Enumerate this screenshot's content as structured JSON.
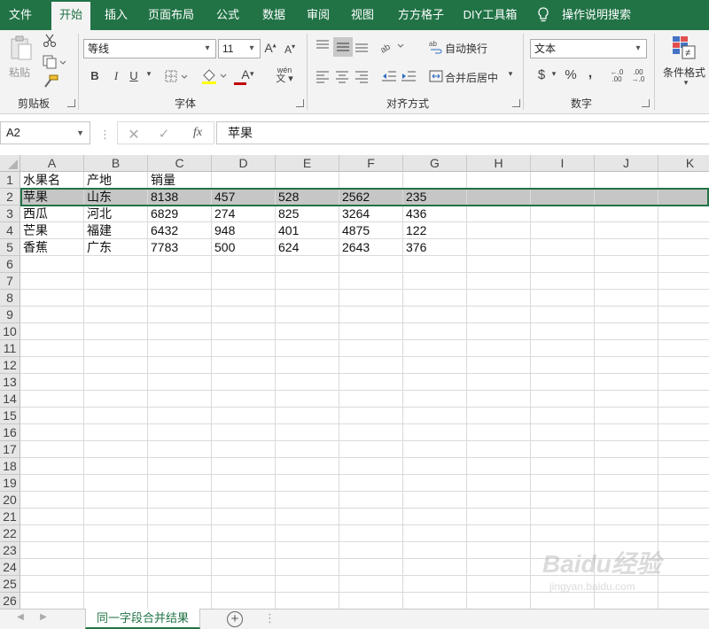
{
  "menu": [
    {
      "label": "文件",
      "active": false
    },
    {
      "label": "开始",
      "active": true
    },
    {
      "label": "插入",
      "active": false
    },
    {
      "label": "页面布局",
      "active": false
    },
    {
      "label": "公式",
      "active": false
    },
    {
      "label": "数据",
      "active": false
    },
    {
      "label": "审阅",
      "active": false
    },
    {
      "label": "视图",
      "active": false
    },
    {
      "label": "方方格子",
      "active": false
    },
    {
      "label": "DIY工具箱",
      "active": false
    },
    {
      "label": "操作说明搜索",
      "active": false
    }
  ],
  "ribbon": {
    "clipboard": {
      "paste_label": "粘贴",
      "group_label": "剪贴板"
    },
    "font": {
      "font_name": "等线",
      "font_size": "11",
      "bold": "B",
      "italic": "I",
      "underline": "U",
      "phonetic": "wén",
      "group_label": "字体",
      "grow": "A",
      "shrink": "A",
      "font_color": "A"
    },
    "alignment": {
      "wrap_text": "自动换行",
      "merge_center": "合并后居中",
      "group_label": "对齐方式"
    },
    "number": {
      "format": "文本",
      "currency": "$",
      "percent": "%",
      "comma": ",",
      "inc_decimal": "←.0 .00",
      "dec_decimal": ".00 →.0",
      "group_label": "数字"
    },
    "styles": {
      "conditional_format": "条件格式"
    }
  },
  "formula_bar": {
    "name_box": "A2",
    "fx": "fx",
    "content": "苹果"
  },
  "grid": {
    "columns": [
      "A",
      "B",
      "C",
      "D",
      "E",
      "F",
      "G",
      "H",
      "I",
      "J",
      "K"
    ],
    "row_numbers": [
      "1",
      "2",
      "3",
      "4",
      "5",
      "6",
      "7",
      "8",
      "9",
      "10",
      "11",
      "12",
      "13",
      "14",
      "15",
      "16",
      "17",
      "18",
      "19",
      "20",
      "21",
      "22",
      "23",
      "24",
      "25",
      "26"
    ],
    "selected_row": 2,
    "active_cell": "A2",
    "rows": [
      [
        "水果名",
        "产地",
        "销量",
        "",
        "",
        "",
        ""
      ],
      [
        "苹果",
        "山东",
        "8138",
        "457",
        "528",
        "2562",
        "235"
      ],
      [
        "西瓜",
        "河北",
        "6829",
        "274",
        "825",
        "3264",
        "436"
      ],
      [
        "芒果",
        "福建",
        "6432",
        "948",
        "401",
        "4875",
        "122"
      ],
      [
        "香蕉",
        "广东",
        "7783",
        "500",
        "624",
        "2643",
        "376"
      ]
    ]
  },
  "sheet_tabs": [
    {
      "label": "同一字段合并结果",
      "active": true
    }
  ],
  "watermark": {
    "brand": "Baidu经验",
    "url": "jingyan.baidu.com"
  },
  "colors": {
    "brand_green": "#217346",
    "ribbon_bg": "#f3f3f3",
    "selected_row_bg": "#c6c6c6"
  }
}
